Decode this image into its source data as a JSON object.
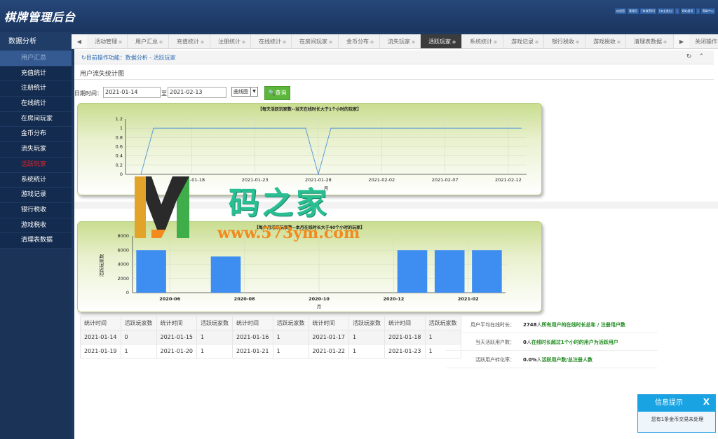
{
  "app": {
    "title": "棋牌管理后台",
    "top_links": [
      "欢迎您",
      "管理员",
      "[修改密码]",
      "[安全退出]",
      "|",
      "网站首页",
      "|",
      "帮助中心"
    ]
  },
  "sidebar": {
    "header": "数据分析",
    "items": [
      {
        "label": "用户汇总",
        "state": "selected"
      },
      {
        "label": "充值统计"
      },
      {
        "label": "注册统计"
      },
      {
        "label": "在线统计"
      },
      {
        "label": "在房间玩家"
      },
      {
        "label": "金币分布"
      },
      {
        "label": "流失玩家"
      },
      {
        "label": "活跃玩家",
        "state": "active"
      },
      {
        "label": "系统统计"
      },
      {
        "label": "游戏记录"
      },
      {
        "label": "银行税收"
      },
      {
        "label": "游戏税收"
      },
      {
        "label": "清理表数据"
      }
    ]
  },
  "tabs": {
    "prev": "◀",
    "next": "▶",
    "close_all": "关闭操作",
    "items": [
      {
        "label": "活动管理"
      },
      {
        "label": "用户汇总"
      },
      {
        "label": "充值统计"
      },
      {
        "label": "注册统计"
      },
      {
        "label": "在线统计"
      },
      {
        "label": "在房间玩家"
      },
      {
        "label": "金币分布"
      },
      {
        "label": "流失玩家"
      },
      {
        "label": "活跃玩家",
        "active": true
      },
      {
        "label": "系统统计"
      },
      {
        "label": "游戏记录"
      },
      {
        "label": "银行税收"
      },
      {
        "label": "游戏税收"
      },
      {
        "label": "清理表数据"
      }
    ]
  },
  "breadcrumb": {
    "text": "↻目前操作功能：数据分析 - 活跃玩家",
    "refresh_icon": "refresh-icon",
    "collapse_icon": "chevron-up-icon"
  },
  "page": {
    "subtitle": "用户流失统计图"
  },
  "filter": {
    "date_label": "日期时间：",
    "start_date": "2021-01-14",
    "to_label": "至",
    "end_date": "2021-02-13",
    "chart_type": "曲线图",
    "query_label": "查询"
  },
  "chart_data": [
    {
      "type": "line",
      "title": "【每天活跃玩家数--当天在线时长大于1个小时的玩家】",
      "xlabel": "月",
      "ylabel": "",
      "ylim": [
        0,
        1.2
      ],
      "yticks": [
        "0",
        "0.2",
        "0.4",
        "0.6",
        "0.8",
        "1",
        "1.2"
      ],
      "xticks": [
        "2021-01-18",
        "2021-01-23",
        "2021-01-28",
        "2021-02-02",
        "2021-02-07",
        "2021-02-12"
      ],
      "series": [
        {
          "values": [
            0,
            1,
            1,
            1,
            1,
            1,
            1,
            1,
            1,
            1,
            1,
            1,
            1,
            1,
            0,
            1,
            1,
            1,
            1,
            1,
            1,
            1,
            1,
            1,
            1,
            1,
            1,
            1,
            1,
            1,
            1
          ]
        }
      ],
      "x_dates": [
        "2021-01-14",
        "2021-01-15",
        "2021-01-16",
        "2021-01-17",
        "2021-01-18",
        "2021-01-19",
        "2021-01-20",
        "2021-01-21",
        "2021-01-22",
        "2021-01-23",
        "2021-01-24",
        "2021-01-25",
        "2021-01-26",
        "2021-01-27",
        "2021-01-28",
        "2021-01-29",
        "2021-01-30",
        "2021-01-31",
        "2021-02-01",
        "2021-02-02",
        "2021-02-03",
        "2021-02-04",
        "2021-02-05",
        "2021-02-06",
        "2021-02-07",
        "2021-02-08",
        "2021-02-09",
        "2021-02-10",
        "2021-02-11",
        "2021-02-12",
        "2021-02-13"
      ],
      "color": "#5b9bd5"
    },
    {
      "type": "bar",
      "title": "【每个月活跃玩家数--本月在线时长大于40个小时的玩家】",
      "xlabel": "月",
      "ylabel": "活跃玩家数",
      "ylim": [
        0,
        8000
      ],
      "yticks": [
        "0",
        "2000",
        "4000",
        "6000",
        "8000"
      ],
      "xticks": [
        "2020-06",
        "2020-08",
        "2020-10",
        "2020-12",
        "2021-02"
      ],
      "categories": [
        "2020-05",
        "2020-06",
        "2020-07",
        "2020-08",
        "2020-09",
        "2020-10",
        "2020-11",
        "2020-12",
        "2021-01",
        "2021-02"
      ],
      "values": [
        6000,
        0,
        5100,
        0,
        0,
        0,
        0,
        6000,
        6000,
        6000
      ],
      "color": "#3d8ef0"
    }
  ],
  "table": {
    "headers": [
      "统计时间",
      "活跃玩家数",
      "统计时间",
      "活跃玩家数",
      "统计时间",
      "活跃玩家数",
      "统计时间",
      "活跃玩家数",
      "统计时间",
      "活跃玩家数"
    ],
    "rows": [
      [
        "2021-01-14",
        "0",
        "2021-01-15",
        "1",
        "2021-01-16",
        "1",
        "2021-01-17",
        "1",
        "2021-01-18",
        "1"
      ],
      [
        "2021-01-19",
        "1",
        "2021-01-20",
        "1",
        "2021-01-21",
        "1",
        "2021-01-22",
        "1",
        "2021-01-23",
        "1"
      ]
    ]
  },
  "summary": [
    {
      "label": "用户平均在线时长：",
      "value": "2748",
      "unit": "人",
      "note": "所有用户的在线时长总和 / 注册用户数"
    },
    {
      "label": "当天活跃用户数：",
      "value": "0",
      "unit": "人",
      "note": "在线时长超过1个小时的用户为活跃用户"
    },
    {
      "label": "活跃用户转化率：",
      "value": "0.0%",
      "unit": "人",
      "note": "活跃用户数/总注册人数"
    }
  ],
  "watermark": {
    "text": "码之家",
    "url": "www.573ym.com"
  },
  "notice": {
    "title": "信息提示",
    "close": "X",
    "message": "您有1条金币交易未处理"
  }
}
